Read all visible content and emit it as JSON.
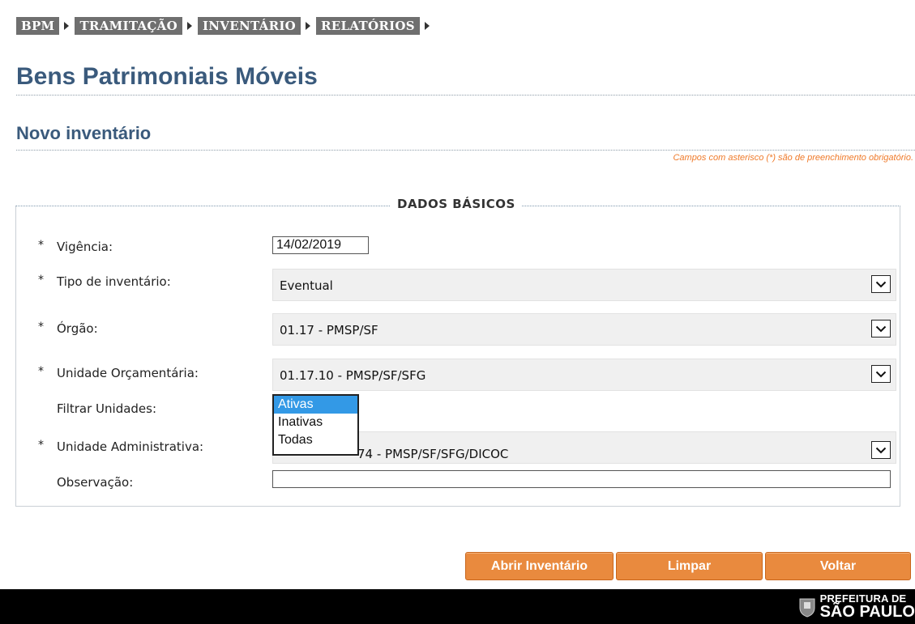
{
  "nav": {
    "items": [
      {
        "label": "BPM"
      },
      {
        "label": "TRAMITAÇÃO"
      },
      {
        "label": "INVENTÁRIO"
      },
      {
        "label": "RELATÓRIOS"
      }
    ]
  },
  "page_title": "Bens Patrimoniais Móveis",
  "section_title": "Novo inventário",
  "required_note": "Campos com asterisco (*) são de preenchimento obrigatório.",
  "form": {
    "legend": "DADOS BÁSICOS",
    "required_mark": "*",
    "vigencia": {
      "label": "Vigência:",
      "value": "14/02/2019"
    },
    "tipo": {
      "label": "Tipo de inventário:",
      "value": "Eventual"
    },
    "orgao": {
      "label": "Órgão:",
      "value": "01.17 - PMSP/SF"
    },
    "unidade_orc": {
      "label": "Unidade Orçamentária:",
      "value": "01.17.10 - PMSP/SF/SFG"
    },
    "filtrar": {
      "label": "Filtrar Unidades:",
      "options": [
        "Ativas",
        "Inativas",
        "Todas"
      ],
      "selected": "Ativas"
    },
    "unidade_adm": {
      "label": "Unidade Administrativa:",
      "value_visible": "74 - PMSP/SF/SFG/DICOC"
    },
    "observacao": {
      "label": "Observação:",
      "value": ""
    }
  },
  "buttons": {
    "abrir": "Abrir Inventário",
    "limpar": "Limpar",
    "voltar": "Voltar"
  },
  "footer": {
    "logo_line1": "PREFEITURA DE",
    "logo_line2": "SÃO PAULO"
  },
  "colors": {
    "nav_bg": "#6f6f6f",
    "title": "#3a5a7c",
    "note": "#ef7a2a",
    "button": "#e98a3e",
    "dropdown_selected": "#3399e6",
    "footer_bg": "#000000"
  }
}
